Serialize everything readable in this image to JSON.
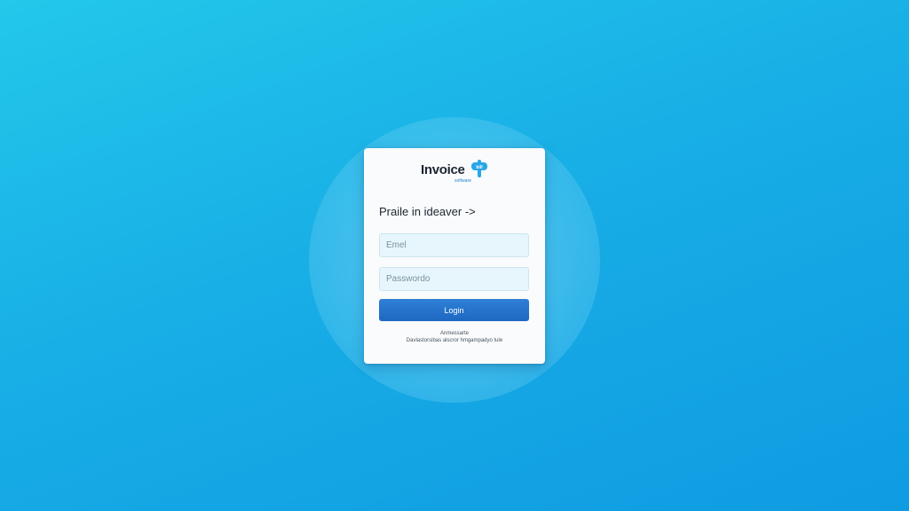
{
  "logo": {
    "word": "Invoice",
    "badge_text": "bill",
    "tagline": "software",
    "colors": {
      "word": "#1d2433",
      "badge": "#2aa6e6"
    }
  },
  "form": {
    "heading": "Praile in ideaver ->",
    "email_placeholder": "Emel",
    "password_placeholder": "Passwordo",
    "login_label": "Login",
    "footer_line1": "Anmessarte",
    "footer_line2": "Davlastorsibas alscror hmgampadyo tule"
  },
  "colors": {
    "background_top": "#23c8ea",
    "background_bottom": "#0f9be2",
    "card": "#f9fbfc",
    "input_fill": "#e6f6fc",
    "button": "#1e68c2"
  }
}
